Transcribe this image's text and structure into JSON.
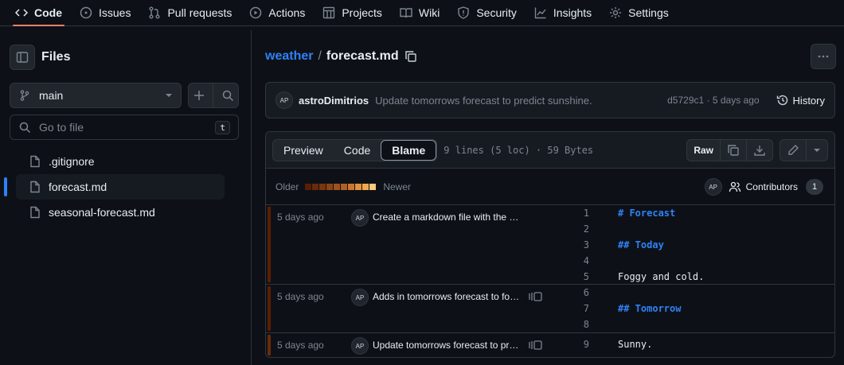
{
  "nav": [
    {
      "label": "Code",
      "icon": "code-icon",
      "active": true
    },
    {
      "label": "Issues",
      "icon": "issues-icon"
    },
    {
      "label": "Pull requests",
      "icon": "pull-request-icon"
    },
    {
      "label": "Actions",
      "icon": "actions-icon"
    },
    {
      "label": "Projects",
      "icon": "projects-icon"
    },
    {
      "label": "Wiki",
      "icon": "wiki-icon"
    },
    {
      "label": "Security",
      "icon": "shield-icon"
    },
    {
      "label": "Insights",
      "icon": "graph-icon"
    },
    {
      "label": "Settings",
      "icon": "gear-icon"
    }
  ],
  "sidebar": {
    "title": "Files",
    "branch": "main",
    "goto_placeholder": "Go to file",
    "goto_shortcut": "t",
    "files": [
      {
        "name": ".gitignore",
        "selected": false
      },
      {
        "name": "forecast.md",
        "selected": true
      },
      {
        "name": "seasonal-forecast.md",
        "selected": false
      }
    ]
  },
  "breadcrumb": {
    "repo": "weather",
    "separator": "/",
    "file": "forecast.md"
  },
  "commit": {
    "avatar": "AP",
    "author": "astroDimitrios",
    "message": "Update tomorrows forecast to predict sunshine.",
    "meta": "d5729c1 · 5 days ago",
    "history_label": "History"
  },
  "file": {
    "tabs": [
      "Preview",
      "Code",
      "Blame"
    ],
    "active_tab": "Blame",
    "info": "9 lines (5 loc) · 59 Bytes",
    "raw_label": "Raw"
  },
  "legend": {
    "older": "Older",
    "newer": "Newer",
    "colors": [
      "#5a1e02",
      "#6b2a0a",
      "#7c3510",
      "#8e4316",
      "#a0511c",
      "#b35f22",
      "#cc7530",
      "#e0913f",
      "#f0a84f",
      "#ffc87a"
    ],
    "contributors_label": "Contributors",
    "contributors_count": "1",
    "avatar": "AP"
  },
  "blame": [
    {
      "date": "5 days ago",
      "avatar": "AP",
      "message": "Create a markdown file with the forecast",
      "reblame": false,
      "color": "#5a1e02",
      "lines": [
        {
          "n": "1",
          "text": "# Forecast",
          "heading": true
        },
        {
          "n": "2",
          "text": "",
          "heading": false
        },
        {
          "n": "3",
          "text": "## Today",
          "heading": true
        },
        {
          "n": "4",
          "text": "",
          "heading": false
        },
        {
          "n": "5",
          "text": "Foggy and cold.",
          "heading": false
        }
      ]
    },
    {
      "date": "5 days ago",
      "avatar": "AP",
      "message": "Adds in tomorrows forecast to forecast.md",
      "reblame": true,
      "color": "#5a1e02",
      "lines": [
        {
          "n": "6",
          "text": "",
          "heading": false
        },
        {
          "n": "7",
          "text": "## Tomorrow",
          "heading": true
        },
        {
          "n": "8",
          "text": "",
          "heading": false
        }
      ]
    },
    {
      "date": "5 days ago",
      "avatar": "AP",
      "message": "Update tomorrows forecast to predict sunshine.",
      "reblame": true,
      "color": "#6b2a0a",
      "lines": [
        {
          "n": "9",
          "text": "Sunny.",
          "heading": false
        }
      ]
    }
  ]
}
